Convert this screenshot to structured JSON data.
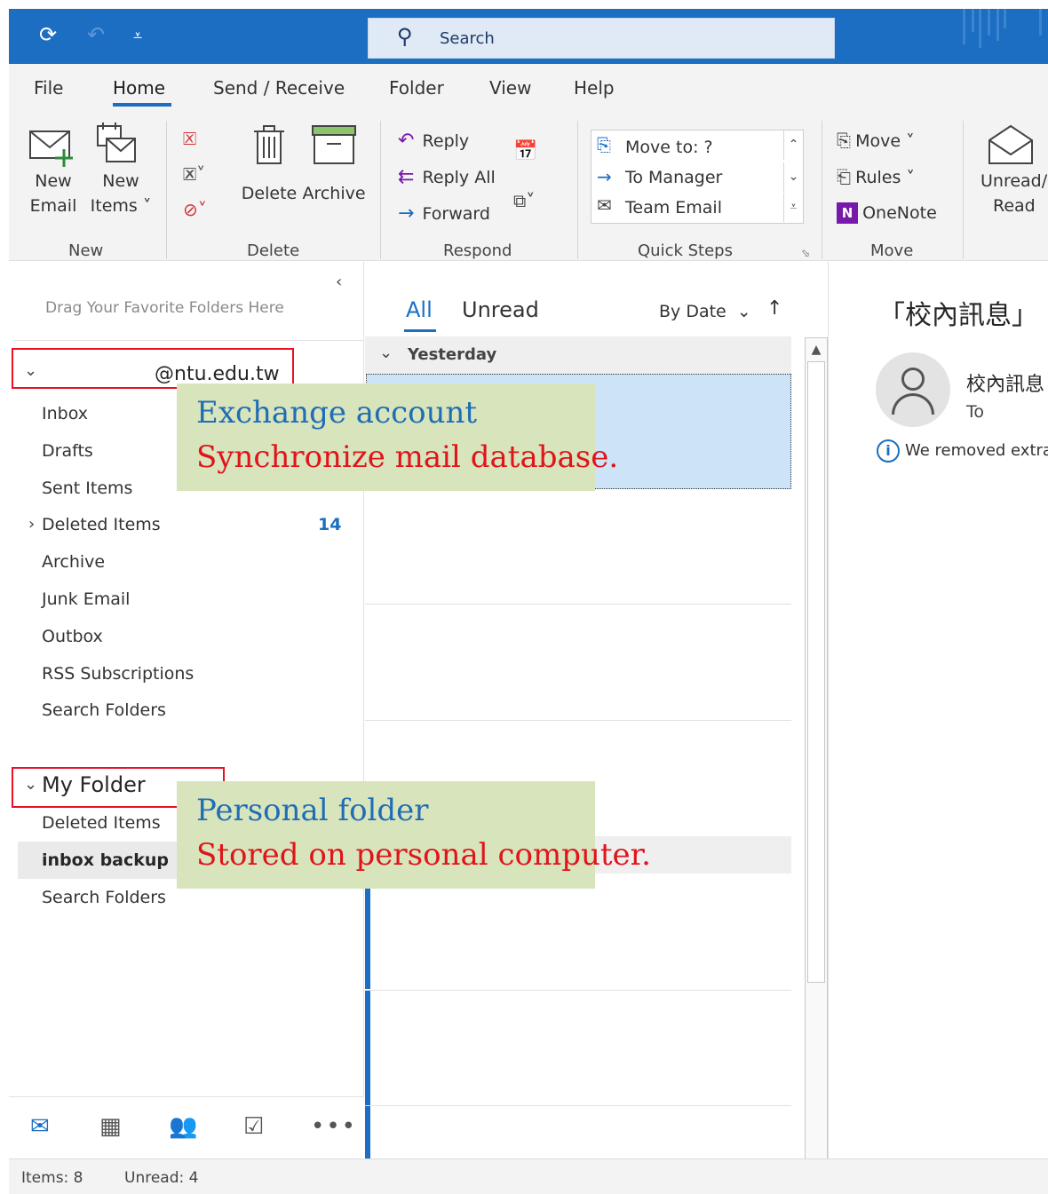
{
  "titlebar": {
    "sync_icon": "refresh-icon",
    "undo_icon": "undo-icon",
    "customize_icon": "dropdown-icon",
    "search_placeholder": "Search"
  },
  "menu": {
    "items": [
      "File",
      "Home",
      "Send / Receive",
      "Folder",
      "View",
      "Help"
    ],
    "active": "Home"
  },
  "ribbon": {
    "new_email": "New\nEmail",
    "new_email_l1": "New",
    "new_email_l2": "Email",
    "new_items_l1": "New",
    "new_items_l2": "Items ˅",
    "delete": "Delete",
    "archive": "Archive",
    "reply": "Reply",
    "reply_all": "Reply All",
    "forward": "Forward",
    "quick_steps": [
      "Move to: ?",
      "To Manager",
      "Team Email"
    ],
    "move": "Move ˅",
    "rules": "Rules ˅",
    "onenote": "OneNote",
    "unread_l1": "Unread/",
    "unread_l2": "Read",
    "groups": [
      "New",
      "Delete",
      "Respond",
      "Quick Steps",
      "Move"
    ]
  },
  "folder_pane": {
    "favorites_hint": "Drag Your Favorite Folders Here",
    "account": "@ntu.edu.tw",
    "folders": [
      {
        "label": "Inbox"
      },
      {
        "label": "Drafts"
      },
      {
        "label": "Sent Items"
      },
      {
        "label": "Deleted Items",
        "count": "14"
      },
      {
        "label": "Archive"
      },
      {
        "label": "Junk Email"
      },
      {
        "label": "Outbox"
      },
      {
        "label": "RSS Subscriptions"
      },
      {
        "label": "Search Folders"
      }
    ],
    "my_folder": "My Folder",
    "my_folders": [
      {
        "label": "Deleted Items"
      },
      {
        "label": "inbox backup"
      },
      {
        "label": "Search Folders"
      }
    ]
  },
  "message_list": {
    "tabs": [
      "All",
      "Unread"
    ],
    "sort_label": "By Date",
    "group_header": "Yesterday"
  },
  "reading_pane": {
    "subject": "「校內訊息」",
    "sender": "校內訊息",
    "to_label": "To",
    "info_text": "We removed extra"
  },
  "status_bar": {
    "items": "Items: 8",
    "unread": "Unread: 4"
  },
  "annotations": {
    "exchange_title": "Exchange account",
    "exchange_desc": "Synchronize mail database.",
    "personal_title": "Personal folder",
    "personal_desc": "Stored on personal computer."
  },
  "colors": {
    "brand": "#1b6ec2",
    "annotation_bg": "#d8e4bc",
    "annotation_title": "#1f6db5",
    "annotation_desc": "#e0141b",
    "highlight_box": "#e81123"
  }
}
